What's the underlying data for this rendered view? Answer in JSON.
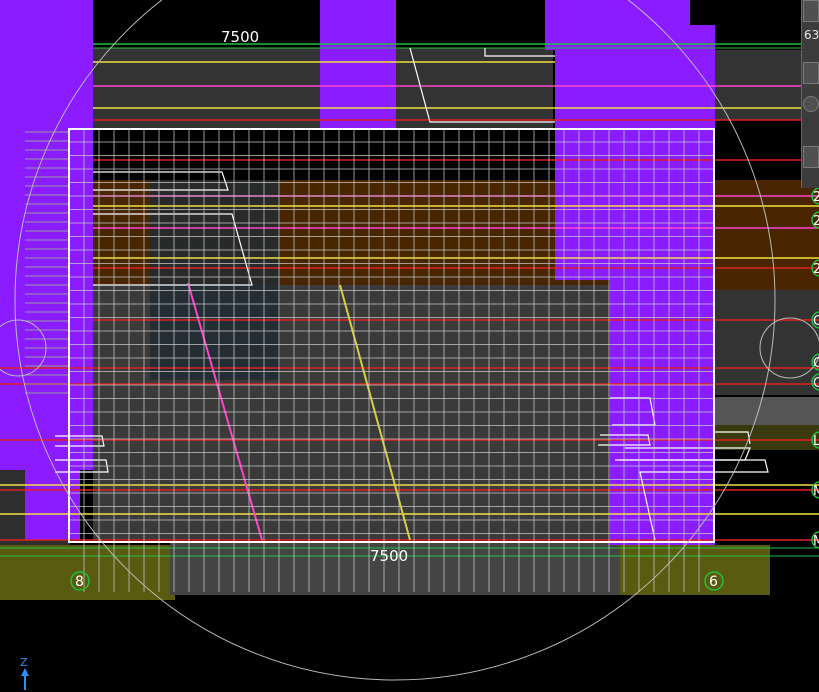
{
  "viewport": {
    "dimension_top": "7500",
    "dimension_bottom": "7500",
    "axis_left": "8",
    "axis_right": "6",
    "toolbar_value": "63"
  },
  "edge_labels": [
    "2",
    "2",
    "2",
    "C",
    "C",
    "C",
    "L",
    "M",
    "M"
  ],
  "ucs": {
    "axis": "Z"
  },
  "colors": {
    "background": "#000000",
    "column": "#8a1cff",
    "slab_dark": "#3a3a3a",
    "slab_brown": "#4a2600",
    "grid": "#d0d0d0",
    "red_line": "#e02020",
    "yellow_line": "#f0e040",
    "magenta_line": "#ff44cc",
    "green_line": "#20c040",
    "olive": "#5a5a10"
  }
}
